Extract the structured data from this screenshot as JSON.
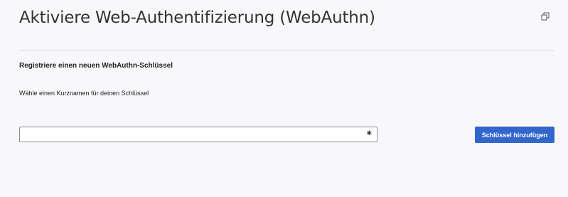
{
  "page": {
    "title": "Aktiviere Web-Authentifizierung (WebAuthn)",
    "popout_icon": "popout-icon"
  },
  "register": {
    "heading": "Registriere einen neuen WebAuthn-Schlüssel",
    "nickname_label": "Wähle einen Kurznamen für deinen Schlüssel",
    "nickname_value": "",
    "nickname_required_marker": "*",
    "add_button_label": "Schlüssel hinzufügen"
  },
  "colors": {
    "background": "#f8f7fa",
    "primary_button": "#3366cc",
    "divider": "#dcdcdc"
  }
}
